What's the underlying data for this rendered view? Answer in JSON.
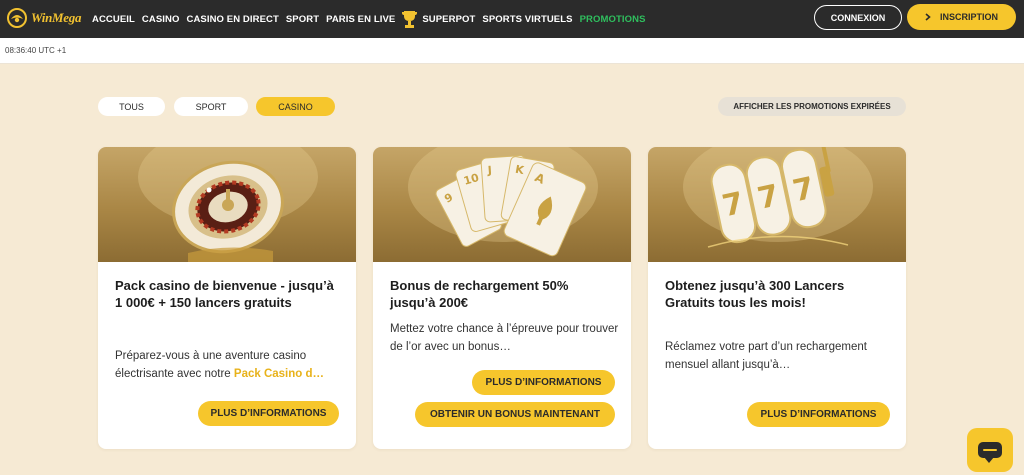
{
  "header": {
    "logo_text": "WinMega",
    "nav": [
      {
        "label": "ACCUEIL"
      },
      {
        "label": "CASINO"
      },
      {
        "label": "CASINO EN DIRECT"
      },
      {
        "label": "SPORT"
      },
      {
        "label": "PARIS EN LIVE"
      },
      {
        "label": "SUPERPOT",
        "icon": "trophy-icon"
      },
      {
        "label": "SPORTS VIRTUELS"
      },
      {
        "label": "PROMOTIONS",
        "active": true
      }
    ],
    "login_label": "CONNEXION",
    "signup_label": "INSCRIPTION",
    "signup_icon": "chevron-right-icon"
  },
  "time": "08:36:40 UTC +1",
  "filters": {
    "all": "TOUS",
    "sport": "SPORT",
    "casino": "CASINO",
    "active": "CASINO",
    "expired_label": "AFFICHER LES PROMOTIONS EXPIRÉES"
  },
  "cards": [
    {
      "image": "roulette-wheel",
      "title": "Pack casino de bienvenue - jusqu’à 1 000€ + 150 lancers gratuits",
      "desc": "Préparez-vous à une aventure casino électrisante avec notre ",
      "desc_highlight": "Pack Casino d…",
      "more_label": "PLUS D’INFORMATIONS"
    },
    {
      "image": "playing-cards",
      "title": "Bonus de rechargement 50% jusqu’à 200€",
      "desc": "Mettez votre chance à l’épreuve pour trouver de l’or avec un bonus…",
      "more_label": "PLUS D’INFORMATIONS",
      "claim_label": "OBTENIR UN BONUS MAINTENANT"
    },
    {
      "image": "slot-machine-777",
      "title": "Obtenez jusqu’à 300 Lancers Gratuits tous les mois!",
      "desc": "Réclamez votre part d’un rechargement mensuel allant jusqu’à…",
      "more_label": "PLUS D’INFORMATIONS"
    }
  ],
  "colors": {
    "header_bg": "#2b2b2b",
    "accent": "#f6c62c",
    "active_nav": "#2fbf5e",
    "page_bg": "#f6ead4"
  }
}
